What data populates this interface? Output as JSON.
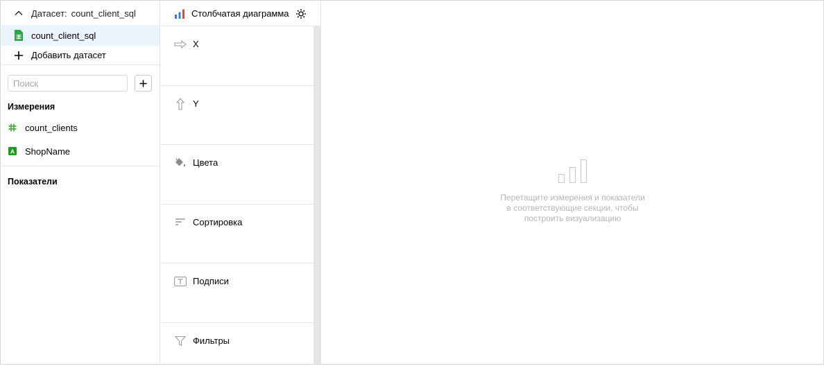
{
  "dataset_panel": {
    "header_label": "Датасет:",
    "header_value": "count_client_sql",
    "selected_dataset": "count_client_sql",
    "add_dataset_label": "Добавить датасет",
    "search_placeholder": "Поиск",
    "dimensions_title": "Измерения",
    "dimensions": [
      {
        "name": "count_clients",
        "icon": "hash-icon",
        "color": "#3db33d"
      },
      {
        "name": "ShopName",
        "icon": "text-type-icon",
        "color": "#1d9c1d"
      }
    ],
    "measures_title": "Показатели"
  },
  "visualization": {
    "chart_type_label": "Столбчатая диаграмма",
    "sections": [
      {
        "label": "X",
        "icon": "arrow-right-icon"
      },
      {
        "label": "Y",
        "icon": "arrow-up-icon"
      },
      {
        "label": "Цвета",
        "icon": "paint-bucket-icon"
      },
      {
        "label": "Сортировка",
        "icon": "sort-icon"
      },
      {
        "label": "Подписи",
        "icon": "text-label-icon"
      },
      {
        "label": "Фильтры",
        "icon": "filter-icon"
      }
    ]
  },
  "canvas": {
    "empty_line1": "Перетащите измерения и показатели",
    "empty_line2": "в соответствующие секции, чтобы",
    "empty_line3": "построить визуализацию"
  },
  "colors": {
    "accent_blue": "#2f7fe0",
    "accent_red": "#e0463a",
    "selected_bg": "#ebf4fd",
    "dataset_green": "#28a745"
  }
}
